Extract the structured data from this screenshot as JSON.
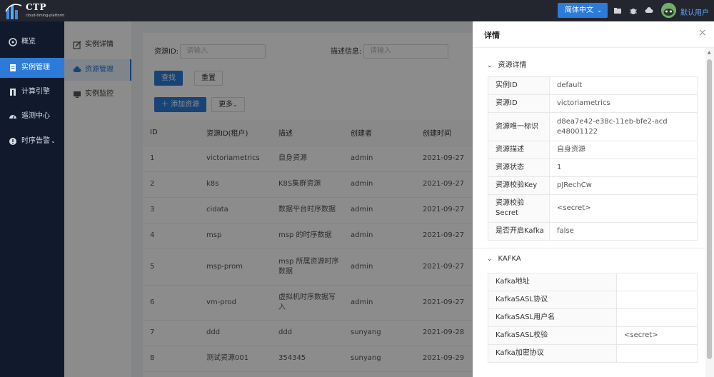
{
  "header": {
    "logo_title": "CTP",
    "logo_subtitle": "cloud-timing-platform",
    "lang_label": "简体中文",
    "user_name": "默认用户"
  },
  "sidebar": {
    "items": [
      {
        "label": "概览",
        "icon": "dashboard-icon"
      },
      {
        "label": "实例管理",
        "icon": "document-icon"
      },
      {
        "label": "计算引擎",
        "icon": "engine-icon"
      },
      {
        "label": "遥测中心",
        "icon": "gauge-icon"
      },
      {
        "label": "时序告警",
        "icon": "alert-icon"
      }
    ]
  },
  "submenu": {
    "items": [
      {
        "label": "实例详情",
        "icon": "edit-icon"
      },
      {
        "label": "资源管理",
        "icon": "cloud-icon"
      },
      {
        "label": "实例监控",
        "icon": "monitor-icon"
      }
    ]
  },
  "search": {
    "resource_id_label": "资源ID:",
    "resource_id_placeholder": "请输入",
    "desc_label": "描述信息:",
    "desc_placeholder": "请输入",
    "query_label": "查找",
    "reset_label": "重置",
    "add_label": "＋  添加资源",
    "more_label": "更多"
  },
  "table": {
    "columns": [
      "ID",
      "资源ID(租户)",
      "描述",
      "创建者",
      "创建时间"
    ],
    "rows": [
      [
        "1",
        "victoriametrics",
        "自身资源",
        "admin",
        "2021-09-27"
      ],
      [
        "2",
        "k8s",
        "K8S集群资源",
        "admin",
        "2021-09-27"
      ],
      [
        "3",
        "cidata",
        "数据平台时序数据",
        "admin",
        "2021-09-27"
      ],
      [
        "4",
        "msp",
        "msp 的时序数据",
        "admin",
        "2021-09-27"
      ],
      [
        "5",
        "msp-prom",
        "msp 所属资源时序数据",
        "admin",
        "2021-09-27"
      ],
      [
        "6",
        "vm-prod",
        "虚拟机时序数据写入",
        "admin",
        "2021-09-27"
      ],
      [
        "7",
        "ddd",
        "ddd",
        "sunyang",
        "2021-09-28"
      ],
      [
        "8",
        "测试资源001",
        "354345",
        "sunyang",
        "2021-09-29"
      ]
    ]
  },
  "drawer": {
    "title": "详情",
    "close": "×",
    "section1_title": "资源详情",
    "resource_rows": [
      {
        "key": "实例ID",
        "value": "default"
      },
      {
        "key": "资源ID",
        "value": "victoriametrics"
      },
      {
        "key": "资源唯一标识",
        "value": "d8ea7e42-e38c-11eb-bfe2-acde48001122"
      },
      {
        "key": "资源描述",
        "value": "自身资源"
      },
      {
        "key": "资源状态",
        "value": "1"
      },
      {
        "key": "资源校验Key",
        "value": "pJRechCw"
      },
      {
        "key": "资源校验Secret",
        "value": "<secret>"
      },
      {
        "key": "是否开启Kafka",
        "value": "false"
      }
    ],
    "section2_title": "KAFKA",
    "kafka_rows": [
      {
        "key": "Kafka地址",
        "value": ""
      },
      {
        "key": "KafkaSASL协议",
        "value": ""
      },
      {
        "key": "KafkaSASL用户名",
        "value": ""
      },
      {
        "key": "KafkaSASL校验",
        "value": "<secret>"
      },
      {
        "key": "Kafka加密协议",
        "value": ""
      }
    ]
  },
  "colors": {
    "primary": "#2d7bd8",
    "sidebar_bg": "#101a2c",
    "header_bg": "#23262e"
  }
}
